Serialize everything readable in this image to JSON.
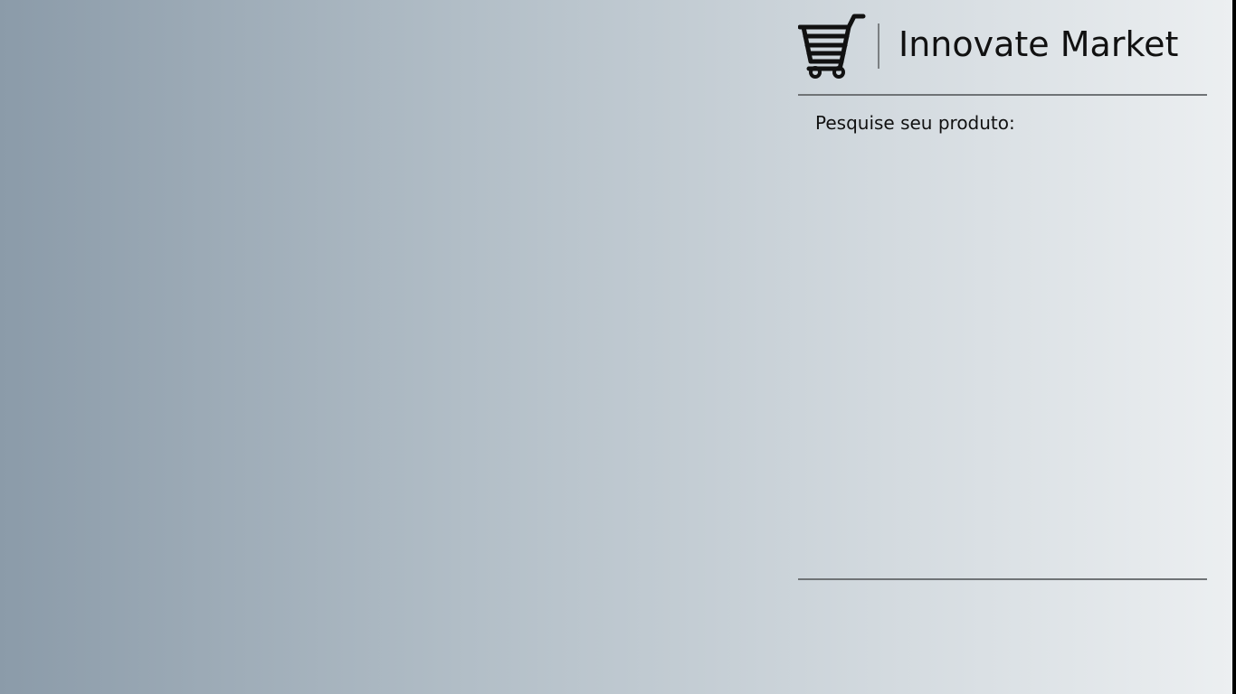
{
  "brand": {
    "name": "Innovate Market",
    "icon": "shopping-cart-icon"
  },
  "search": {
    "label": "Pesquise seu produto:"
  },
  "colors": {
    "gradient_start": "#8b9ba9",
    "gradient_end": "#eceff1",
    "divider": "#6f7376",
    "text": "#111111"
  }
}
